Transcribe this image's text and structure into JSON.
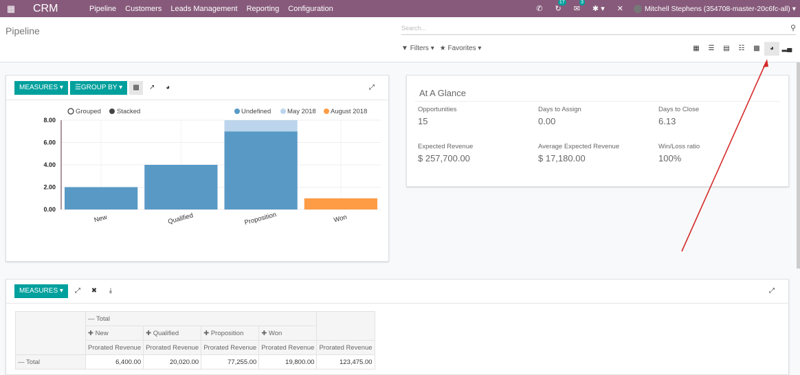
{
  "topbar": {
    "app_name": "CRM",
    "menu": [
      "Pipeline",
      "Customers",
      "Leads Management",
      "Reporting",
      "Configuration"
    ],
    "activity_count": "17",
    "message_count": "3",
    "user": "Mitchell Stephens (354708-master-20c6fc-all)"
  },
  "control_panel": {
    "breadcrumb": "Pipeline",
    "search_placeholder": "Search...",
    "filters_label": "Filters",
    "favorites_label": "Favorites",
    "views": [
      "kanban",
      "list",
      "calendar",
      "pivot",
      "graph",
      "dashboard",
      "cohort"
    ],
    "active_view": "dashboard"
  },
  "graph_card": {
    "measures_label": "MEASURES",
    "group_by_label": "GROUP BY",
    "mode_grouped": "Grouped",
    "mode_stacked": "Stacked"
  },
  "chart_data": {
    "type": "bar",
    "stacked": true,
    "categories": [
      "New",
      "Qualified",
      "Proposition",
      "Won"
    ],
    "series": [
      {
        "name": "Undefined",
        "color": "#5899c6",
        "values": [
          2,
          4,
          7,
          0
        ]
      },
      {
        "name": "May 2018",
        "color": "#bcd5ec",
        "values": [
          0,
          0,
          1,
          0
        ]
      },
      {
        "name": "August 2018",
        "color": "#fd9c45",
        "values": [
          0,
          0,
          0,
          1
        ]
      }
    ],
    "yticks": [
      "0.00",
      "2.00",
      "4.00",
      "6.00",
      "8.00"
    ],
    "ylim": [
      0,
      8
    ],
    "grid": true,
    "legend": "top-right"
  },
  "glance": {
    "title": "At A Glance",
    "stats": [
      {
        "label": "Opportunities",
        "value": "15"
      },
      {
        "label": "Days to Assign",
        "value": "0.00"
      },
      {
        "label": "Days to Close",
        "value": "6.13"
      },
      {
        "label": "Expected Revenue",
        "value": "$ 257,700.00"
      },
      {
        "label": "Average Expected Revenue",
        "value": "$ 17,180.00"
      },
      {
        "label": "Win/Loss ratio",
        "value": "100%"
      }
    ]
  },
  "pivot": {
    "measures_label": "MEASURES",
    "col_total": "Total",
    "columns": [
      "New",
      "Qualified",
      "Proposition",
      "Won"
    ],
    "measure": "Prorated Revenue",
    "row_total": "Total",
    "values": [
      "6,400.00",
      "20,020.00",
      "77,255.00",
      "19,800.00",
      "123,475.00"
    ]
  }
}
